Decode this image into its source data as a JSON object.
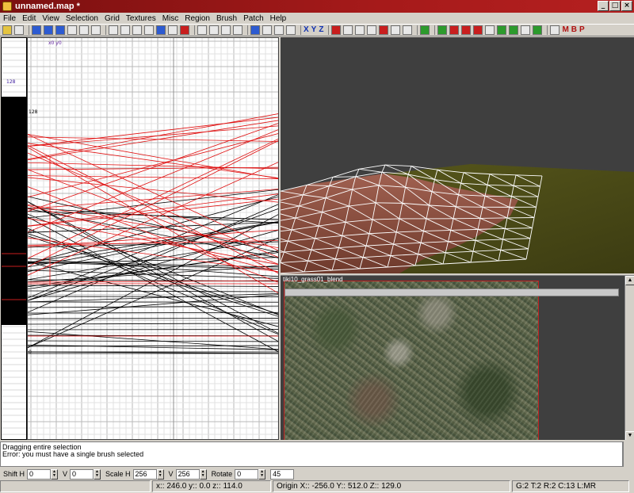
{
  "window": {
    "title": "unnamed.map *",
    "minimize": "_",
    "maximize": "□",
    "close": "×"
  },
  "menu": [
    "File",
    "Edit",
    "View",
    "Selection",
    "Grid",
    "Textures",
    "Misc",
    "Region",
    "Brush",
    "Patch",
    "Help"
  ],
  "toolbar": {
    "text_buttons": [
      "M",
      "B",
      "P"
    ],
    "grid_view_letters": [
      "X",
      "Y",
      "Z"
    ]
  },
  "views": {
    "grid": {
      "origin_label": "x0 y0",
      "top_coord": "128",
      "mid_coord": "64",
      "bottom_coord": "0",
      "z_coord": "128"
    },
    "texture_browser": {
      "name": "tiki10_grass01_blend"
    }
  },
  "console": {
    "lines": [
      "Dragging entire selection",
      "Error: you must have a single brush selected"
    ]
  },
  "texture_bar": {
    "shift_h_label": "Shift H",
    "shift_h": "0",
    "shift_v_label": "V",
    "shift_v": "0",
    "scale_h_label": "Scale H",
    "scale_h": "256",
    "scale_v_label": "V",
    "scale_v": "256",
    "rotate_label": "Rotate",
    "rotate": "0",
    "rotate_step": "45"
  },
  "status": {
    "cursor": "x:: 246.0  y:: 0.0  z:: 114.0",
    "origin": "Origin X:: -256.0  Y:: 512.0  Z:: 129.0",
    "grid_info": "G:2 T:2 R:2 C:13 L:MR"
  },
  "colors": {
    "titlebar": "#a61a1a",
    "wire_selected": "#e01010",
    "wire_unselected": "#000000",
    "camera_bg": "#3f3f3f",
    "terrain": "#8a5040",
    "grass": "#4a4a18"
  }
}
